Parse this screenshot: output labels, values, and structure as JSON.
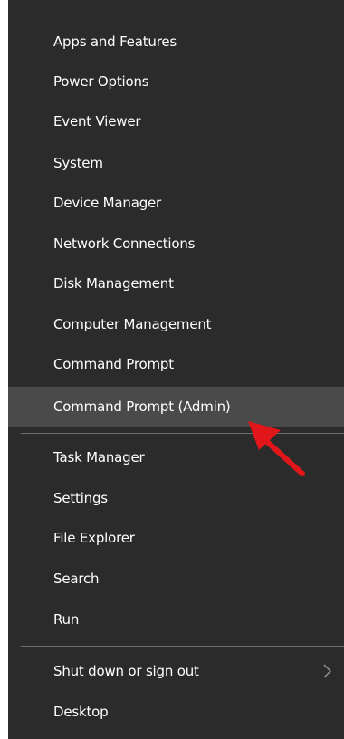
{
  "menu": {
    "items": [
      {
        "label": "Apps and Features"
      },
      {
        "label": "Power Options"
      },
      {
        "label": "Event Viewer"
      },
      {
        "label": "System"
      },
      {
        "label": "Device Manager"
      },
      {
        "label": "Network Connections"
      },
      {
        "label": "Disk Management"
      },
      {
        "label": "Computer Management"
      },
      {
        "label": "Command Prompt"
      },
      {
        "label": "Command Prompt (Admin)",
        "highlighted": true
      },
      {
        "label": "Task Manager"
      },
      {
        "label": "Settings"
      },
      {
        "label": "File Explorer"
      },
      {
        "label": "Search"
      },
      {
        "label": "Run"
      },
      {
        "label": "Shut down or sign out",
        "has_submenu": true
      },
      {
        "label": "Desktop"
      }
    ]
  },
  "colors": {
    "menu_background": "#2b2b2b",
    "highlight_background": "#4a4a4a",
    "separator": "#6d6d6d",
    "text": "#ffffff",
    "annotation_arrow": "#e0161b"
  },
  "icons": {
    "submenu": "chevron-right-icon",
    "annotation": "red-arrow-icon"
  }
}
